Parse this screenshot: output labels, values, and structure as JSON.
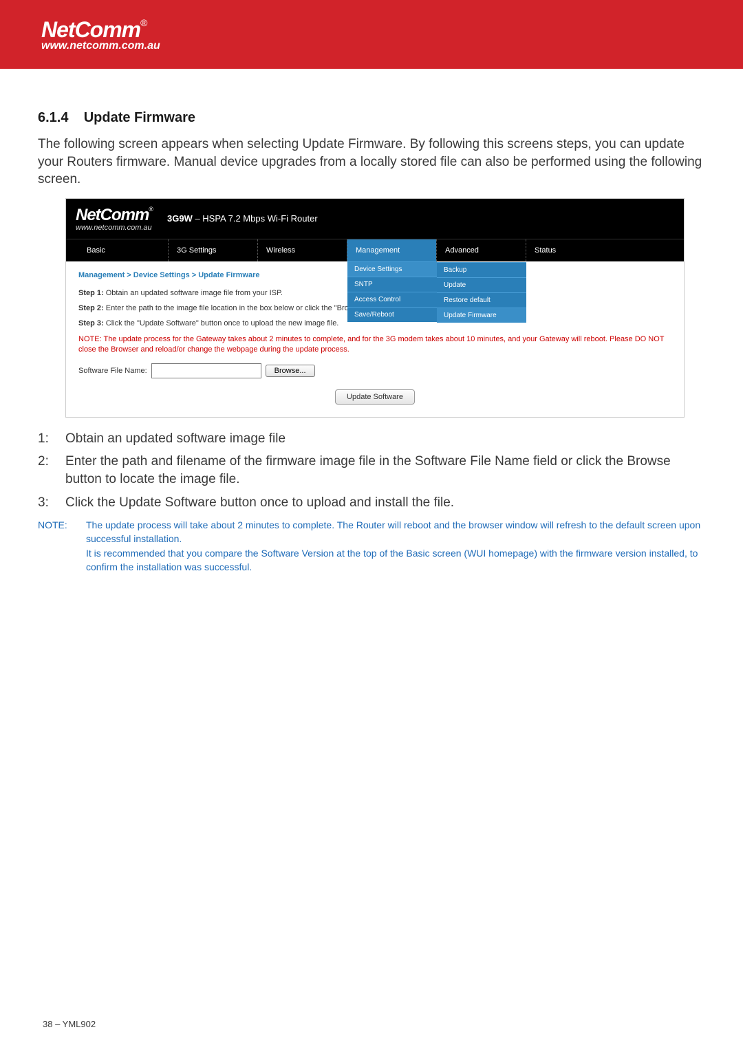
{
  "brand": {
    "name": "NetComm",
    "url": "www.netcomm.com.au",
    "reg": "®"
  },
  "section": {
    "number": "6.1.4",
    "title": "Update Firmware"
  },
  "intro": "The following screen appears when selecting Update Firmware. By following this screens steps, you can update your Routers firmware. Manual device upgrades from a locally stored file can also be performed using the following screen.",
  "router": {
    "logo": "NetComm",
    "logo_reg": "®",
    "logo_url": "www.netcomm.com.au",
    "model_bold": "3G9W",
    "model_sep": " – ",
    "model_rest": "HSPA 7.2 Mbps Wi-Fi Router",
    "tabs": {
      "basic": "Basic",
      "settings": "3G Settings",
      "wireless": "Wireless",
      "management": "Management",
      "advanced": "Advanced",
      "status": "Status"
    },
    "mgmt_menu": {
      "device_settings": "Device Settings",
      "sntp": "SNTP",
      "access_control": "Access Control",
      "save_reboot": "Save/Reboot"
    },
    "device_submenu": {
      "backup": "Backup",
      "update": "Update",
      "restore": "Restore default",
      "update_firmware": "Update Firmware"
    },
    "breadcrumb": "Management > Device Settings > Update Firmware",
    "step1_label": "Step 1:",
    "step1_text": " Obtain an updated software image file from your ISP.",
    "step2_label": "Step 2:",
    "step2_text": " Enter the path to the image file location in the box below or click the \"Browse\" button to locate the image file.",
    "step3_label": "Step 3:",
    "step3_text": " Click the \"Update Software\" button once to upload the new image file.",
    "note": "NOTE: The update process for the Gateway takes about 2 minutes to complete, and for the 3G modem takes about 10 minutes, and your Gateway will reboot. Please DO NOT close the Browser and reload/or change the webpage during the update process.",
    "file_label": "Software File Name:",
    "browse": "Browse...",
    "update_btn": "Update Software"
  },
  "steps": {
    "s1": "Obtain an updated software image file",
    "s2": "Enter the path and filename of the firmware image file in the Software File Name field or click the Browse button to locate the image file.",
    "s3": "Click the Update Software button once to upload and install the file."
  },
  "note_block": {
    "label": "NOTE:",
    "line1": "The update process will take about 2 minutes to complete.  The Router will reboot and the browser window will refresh to the default screen upon successful installation.",
    "line2": "It is recommended that you compare the Software Version at the top of the Basic screen (WUI homepage) with the firmware version installed, to confirm the installation was successful."
  },
  "footer": "38 – YML902"
}
